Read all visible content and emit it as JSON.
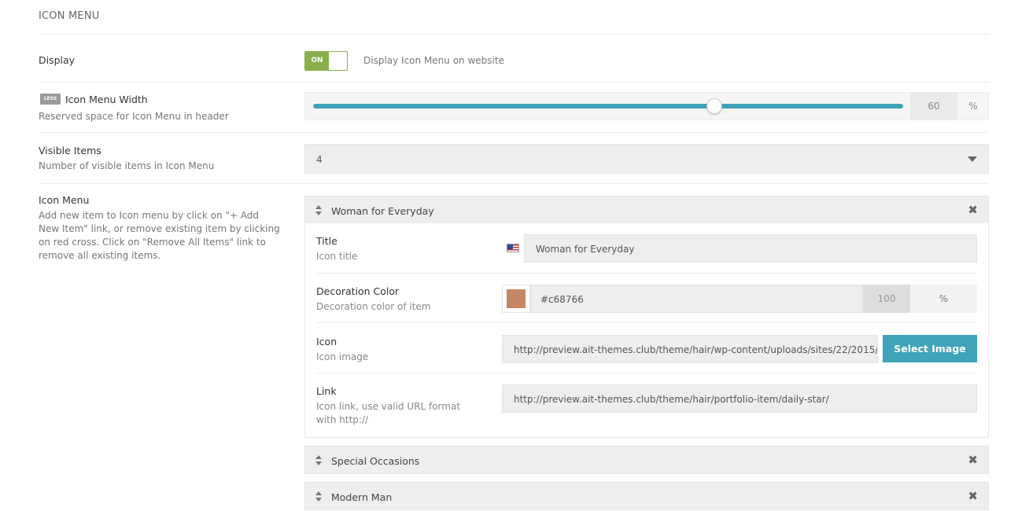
{
  "section": {
    "title": "ICON MENU"
  },
  "display": {
    "label": "Display",
    "toggle_state": "ON",
    "description": "Display Icon Menu on website"
  },
  "width": {
    "badge": "LESS",
    "label": "Icon Menu Width",
    "help": "Reserved space for Icon Menu in header",
    "value": "60",
    "unit": "%",
    "slider_fraction": 0.68,
    "track_color": "#3fa4ba"
  },
  "visible_items": {
    "label": "Visible Items",
    "help": "Number of visible items in Icon Menu",
    "selected": "4"
  },
  "icon_menu": {
    "label": "Icon Menu",
    "help_lines": [
      "Add new item to Icon menu by click on \"+ Add",
      "New Item\" link, or remove existing item by clicking",
      "on red cross. Click on \"Remove All Items\" link to",
      "remove all existing items."
    ],
    "items": [
      {
        "title": "Woman for Everyday",
        "remove_icon": "close-icon"
      },
      {
        "title": "Special Occasions",
        "remove_icon": "close-icon"
      },
      {
        "title": "Modern Man",
        "remove_icon": "close-icon"
      }
    ],
    "expanded": {
      "title_label": "Title",
      "title_help": "Icon title",
      "title_value": "Woman for Everyday",
      "flag_icon": "us-flag-icon",
      "color_label": "Decoration Color",
      "color_help": "Decoration color of item",
      "color_value": "#c68766",
      "opacity_value": "100",
      "opacity_unit": "%",
      "icon_label": "Icon",
      "icon_help": "Icon image",
      "icon_value": "http://preview.ait-themes.club/theme/hair/wp-content/uploads/sites/22/2015/",
      "select_image": "Select Image",
      "link_label": "Link",
      "link_help_lines": [
        "Icon link, use valid URL format",
        "with http://"
      ],
      "link_value": "http://preview.ait-themes.club/theme/hair/portfolio-item/daily-star/"
    }
  },
  "colors": {
    "accent": "#3fa4ba",
    "toggle_on": "#8ab04b",
    "swatch": "#c68766"
  }
}
